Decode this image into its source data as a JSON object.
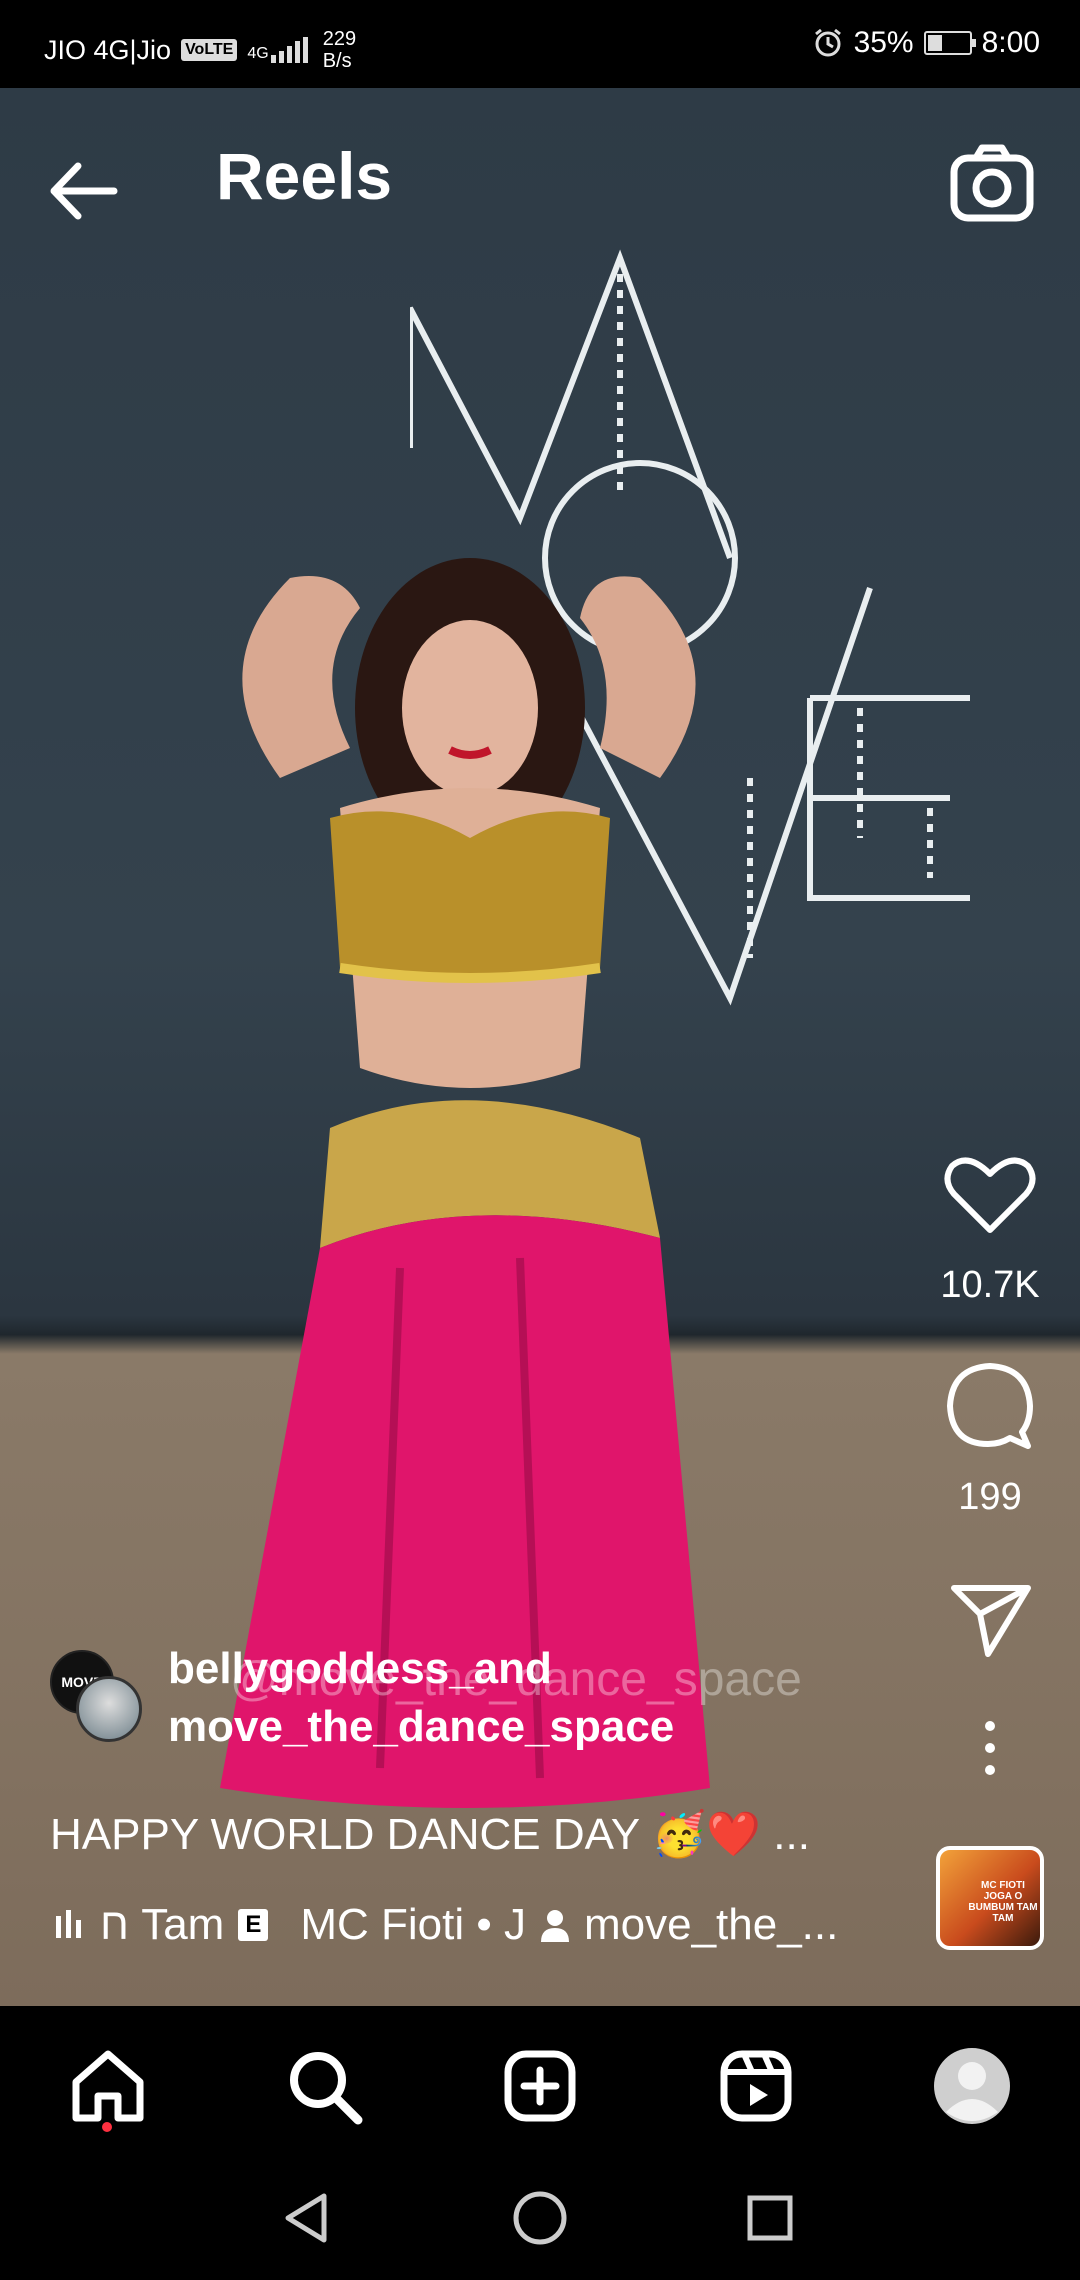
{
  "status_bar": {
    "carrier": "JIO 4G|Jio",
    "volte": "VoLTE",
    "network": "4G",
    "net_speed_value": "229",
    "net_speed_unit": "B/s",
    "battery": "35%",
    "time": "8:00",
    "battery_level": 0.35
  },
  "header": {
    "title": "Reels",
    "back_icon": "arrow-left-icon",
    "camera_icon": "camera-icon"
  },
  "reel": {
    "likes": "10.7K",
    "comments": "199",
    "author": "bellygoddess_and",
    "coauthor": "move_the_dance_space",
    "caption_text": "HAPPY WORLD DANCE DAY 🥳❤️ ...",
    "watermark": "@move_the_dance_space",
    "wall_logo": "MOVE",
    "avatar_logo": "MOVE",
    "music_prefix": "ח Tam",
    "explicit": "E",
    "music_artist": "MC Fioti • J",
    "tagged_user": "move_the_...",
    "album_art_text": "MC FIOTI JOGA O BUMBUM TAM TAM"
  },
  "bottom_nav": {
    "items": [
      "home-icon",
      "search-icon",
      "create-icon",
      "reels-icon",
      "profile-icon"
    ]
  },
  "system_nav": [
    "back-triangle-icon",
    "home-circle-icon",
    "recents-square-icon"
  ],
  "colors": {
    "accent_dot": "#ff3040",
    "skirt": "#e0156b",
    "wall": "#33414c"
  }
}
